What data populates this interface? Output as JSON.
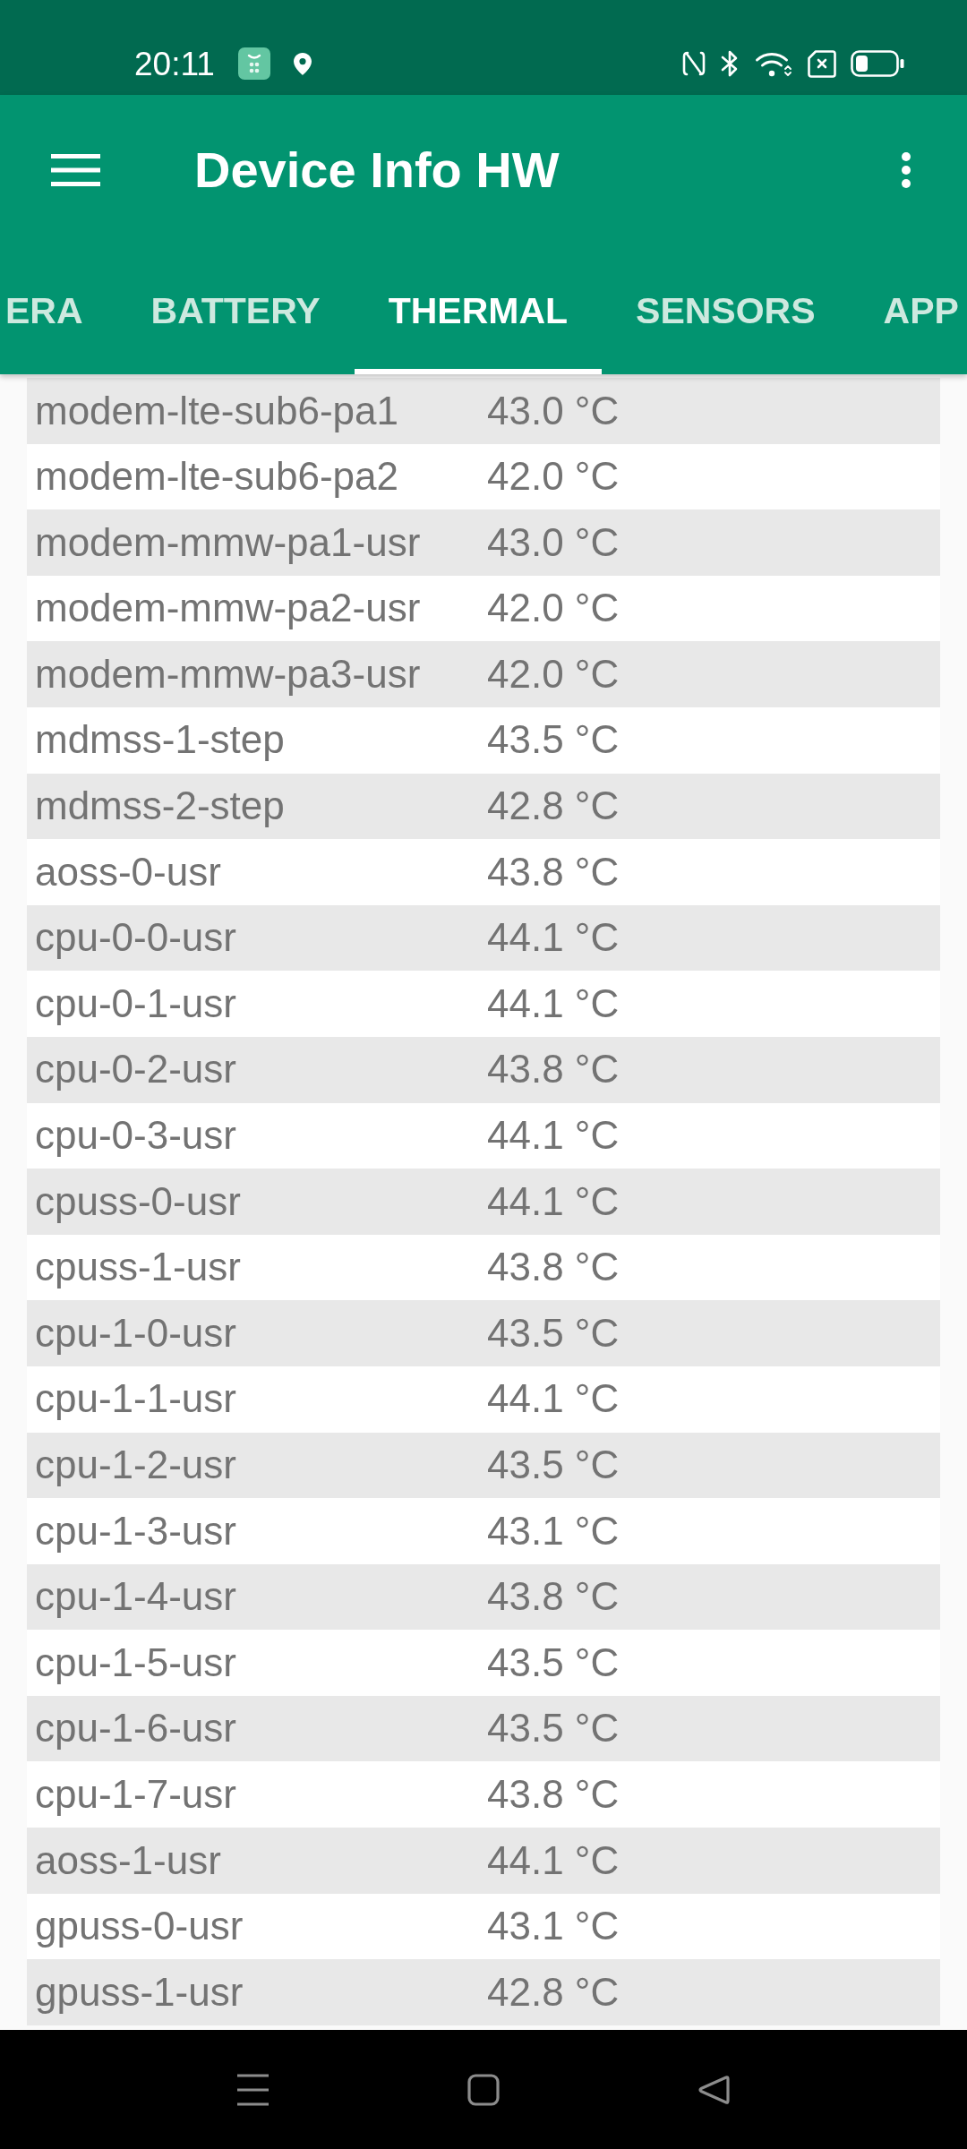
{
  "status_bar": {
    "time": "20:11"
  },
  "app_bar": {
    "title": "Device Info HW"
  },
  "tabs": [
    {
      "label": "ERA",
      "selected": false
    },
    {
      "label": "BATTERY",
      "selected": false
    },
    {
      "label": "THERMAL",
      "selected": true
    },
    {
      "label": "SENSORS",
      "selected": false
    },
    {
      "label": "APP",
      "selected": false
    }
  ],
  "thermal_zones": [
    {
      "sensor": "modem-lte-sub6-pa1",
      "temperature": "43.0 °C"
    },
    {
      "sensor": "modem-lte-sub6-pa2",
      "temperature": "42.0 °C"
    },
    {
      "sensor": "modem-mmw-pa1-usr",
      "temperature": "43.0 °C"
    },
    {
      "sensor": "modem-mmw-pa2-usr",
      "temperature": "42.0 °C"
    },
    {
      "sensor": "modem-mmw-pa3-usr",
      "temperature": "42.0 °C"
    },
    {
      "sensor": "mdmss-1-step",
      "temperature": "43.5 °C"
    },
    {
      "sensor": "mdmss-2-step",
      "temperature": "42.8 °C"
    },
    {
      "sensor": "aoss-0-usr",
      "temperature": "43.8 °C"
    },
    {
      "sensor": "cpu-0-0-usr",
      "temperature": "44.1 °C"
    },
    {
      "sensor": "cpu-0-1-usr",
      "temperature": "44.1 °C"
    },
    {
      "sensor": "cpu-0-2-usr",
      "temperature": "43.8 °C"
    },
    {
      "sensor": "cpu-0-3-usr",
      "temperature": "44.1 °C"
    },
    {
      "sensor": "cpuss-0-usr",
      "temperature": "44.1 °C"
    },
    {
      "sensor": "cpuss-1-usr",
      "temperature": "43.8 °C"
    },
    {
      "sensor": "cpu-1-0-usr",
      "temperature": "43.5 °C"
    },
    {
      "sensor": "cpu-1-1-usr",
      "temperature": "44.1 °C"
    },
    {
      "sensor": "cpu-1-2-usr",
      "temperature": "43.5 °C"
    },
    {
      "sensor": "cpu-1-3-usr",
      "temperature": "43.1 °C"
    },
    {
      "sensor": "cpu-1-4-usr",
      "temperature": "43.8 °C"
    },
    {
      "sensor": "cpu-1-5-usr",
      "temperature": "43.5 °C"
    },
    {
      "sensor": "cpu-1-6-usr",
      "temperature": "43.5 °C"
    },
    {
      "sensor": "cpu-1-7-usr",
      "temperature": "43.8 °C"
    },
    {
      "sensor": "aoss-1-usr",
      "temperature": "44.1 °C"
    },
    {
      "sensor": "gpuss-0-usr",
      "temperature": "43.1 °C"
    },
    {
      "sensor": "gpuss-1-usr",
      "temperature": "42.8 °C"
    }
  ]
}
